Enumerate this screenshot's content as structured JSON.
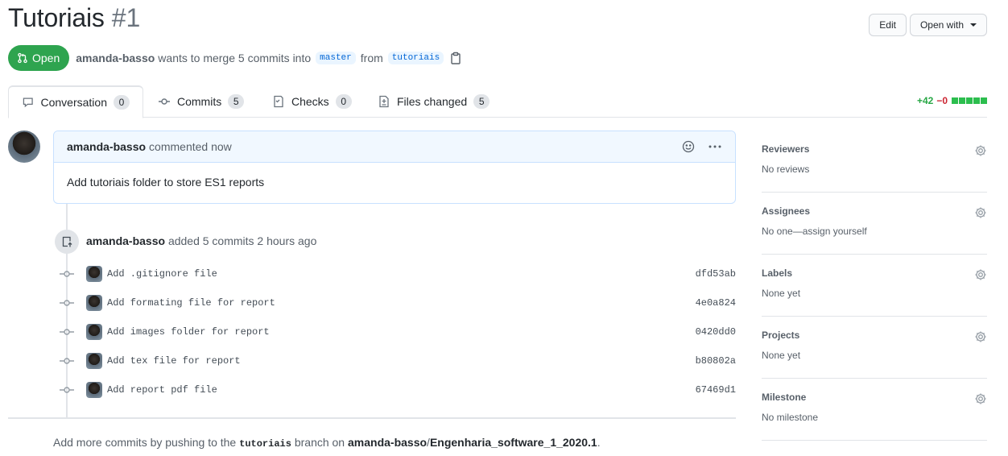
{
  "header": {
    "title": "Tutoriais",
    "number": "#1",
    "edit_label": "Edit",
    "open_with_label": "Open with"
  },
  "meta": {
    "state": "Open",
    "author": "amanda-basso",
    "wants_to_merge": "wants to merge 5 commits into",
    "base_branch": "master",
    "from": "from",
    "head_branch": "tutoriais"
  },
  "tabs": [
    {
      "label": "Conversation",
      "count": "0"
    },
    {
      "label": "Commits",
      "count": "5"
    },
    {
      "label": "Checks",
      "count": "0"
    },
    {
      "label": "Files changed",
      "count": "5"
    }
  ],
  "diffstat": {
    "additions": "+42",
    "deletions": "−0"
  },
  "comment": {
    "author": "amanda-basso",
    "action": "commented now",
    "body": "Add tutoriais folder to store ES1 reports"
  },
  "push": {
    "author": "amanda-basso",
    "text": "added 5 commits 2 hours ago"
  },
  "commits": [
    {
      "message": "Add .gitignore file",
      "sha": "dfd53ab"
    },
    {
      "message": "Add formating file for report",
      "sha": "4e0a824"
    },
    {
      "message": "Add images folder for report",
      "sha": "0420dd0"
    },
    {
      "message": "Add tex file for report",
      "sha": "b80802a"
    },
    {
      "message": "Add report pdf file",
      "sha": "67469d1"
    }
  ],
  "footer": {
    "prefix": "Add more commits by pushing to the",
    "branch": "tutoriais",
    "middle": "branch on",
    "repo_owner": "amanda-basso",
    "slash": "/",
    "repo_name": "Engenharia_software_1_2020.1",
    "suffix": "."
  },
  "sidebar": [
    {
      "title": "Reviewers",
      "value": "No reviews"
    },
    {
      "title": "Assignees",
      "value": "No one—assign yourself"
    },
    {
      "title": "Labels",
      "value": "None yet"
    },
    {
      "title": "Projects",
      "value": "None yet"
    },
    {
      "title": "Milestone",
      "value": "No milestone"
    }
  ],
  "colors": {
    "open_green": "#2ea44f",
    "link_blue": "#0366d6",
    "diff_add": "#28a745",
    "diff_del": "#cb2431"
  }
}
